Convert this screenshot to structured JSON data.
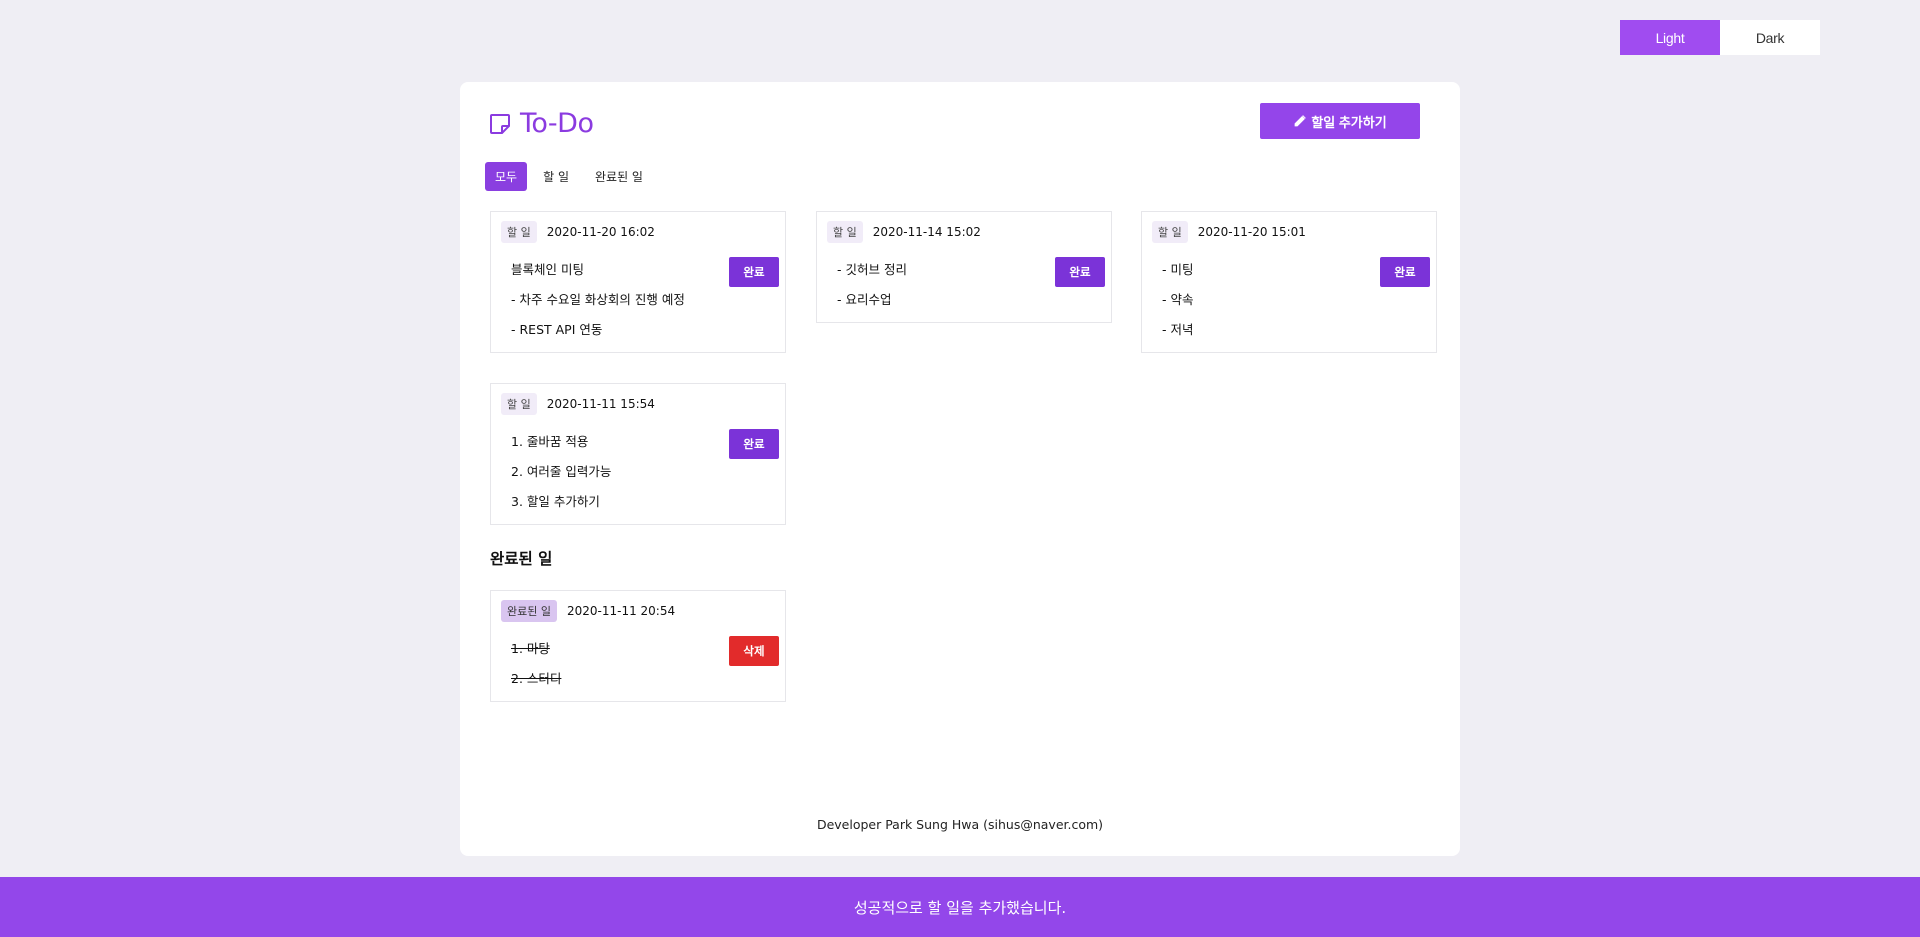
{
  "theme": {
    "light_label": "Light",
    "dark_label": "Dark",
    "active": "light"
  },
  "header": {
    "title": "To-Do",
    "add_button_label": "할일 추가하기"
  },
  "tabs": [
    {
      "label": "모두",
      "active": true
    },
    {
      "label": "할 일",
      "active": false
    },
    {
      "label": "완료된 일",
      "active": false
    }
  ],
  "todos": [
    {
      "status": "할 일",
      "date": "2020-11-20 16:02",
      "lines": [
        "블록체인 미팅",
        "- 차주 수요일 화상회의 진행 예정",
        "- REST API 연동"
      ],
      "action": "완료"
    },
    {
      "status": "할 일",
      "date": "2020-11-14 15:02",
      "lines": [
        "- 깃허브 정리",
        "- 요리수업"
      ],
      "action": "완료"
    },
    {
      "status": "할 일",
      "date": "2020-11-20 15:01",
      "lines": [
        "- 미팅",
        "- 약속",
        "- 저녁"
      ],
      "action": "완료"
    },
    {
      "status": "할 일",
      "date": "2020-11-11 15:54",
      "lines": [
        "1. 줄바꿈 적용",
        "2. 여러줄 입력가능",
        "3. 할일 추가하기"
      ],
      "action": "완료"
    }
  ],
  "done_section": {
    "title": "완료된 일"
  },
  "done": [
    {
      "status": "완료된 일",
      "date": "2020-11-11 20:54",
      "lines": [
        "1. 마탕",
        "2. 스터디"
      ],
      "action": "삭제"
    }
  ],
  "footer": {
    "credit": "Developer Park Sung Hwa (sihus@naver.com)"
  },
  "toast": {
    "message": "성공적으로 할 일을 추가했습니다."
  },
  "colors": {
    "accent": "#9445ea",
    "delete": "#e22b2b",
    "background": "#efeef4"
  }
}
